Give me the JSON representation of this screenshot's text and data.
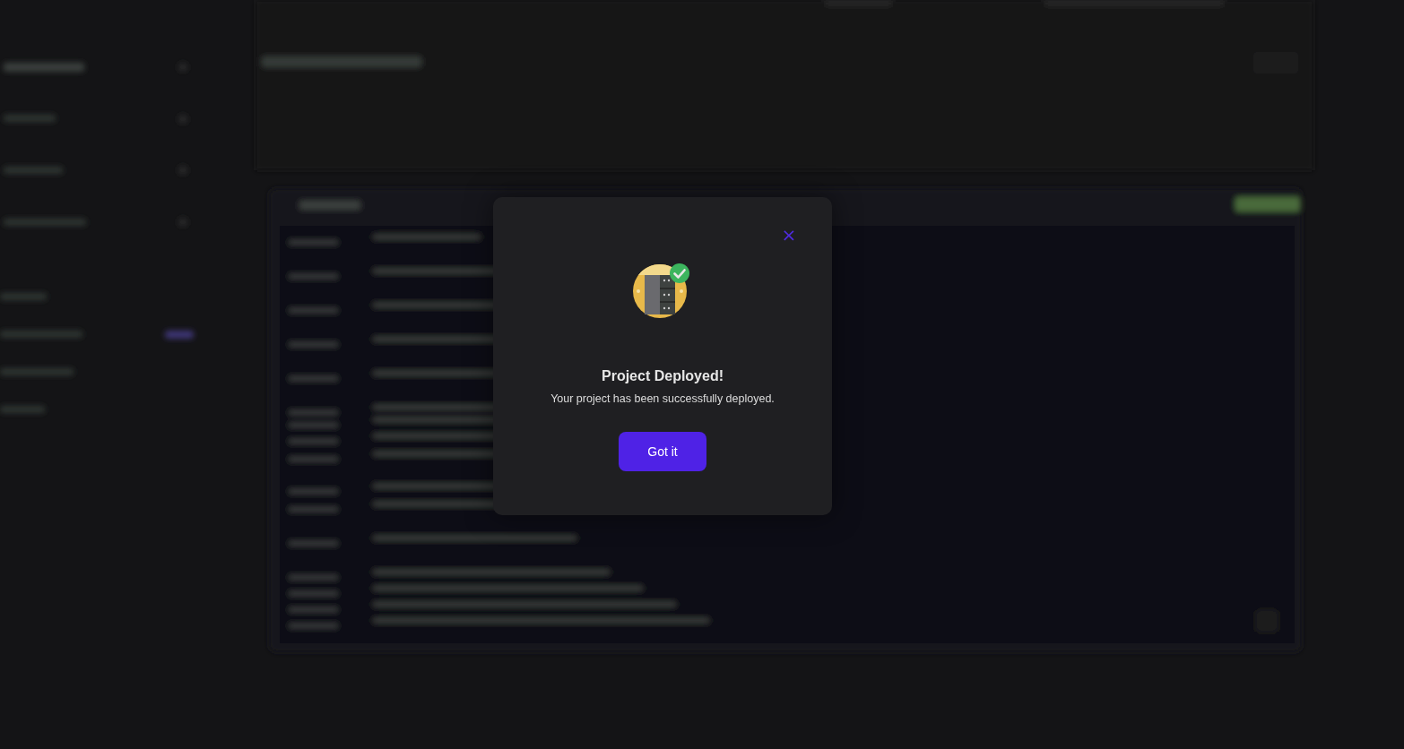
{
  "dialog": {
    "close_label": "×",
    "title": "Project Deployed!",
    "message": "Your project has been successfully deployed.",
    "button": "Got it"
  }
}
